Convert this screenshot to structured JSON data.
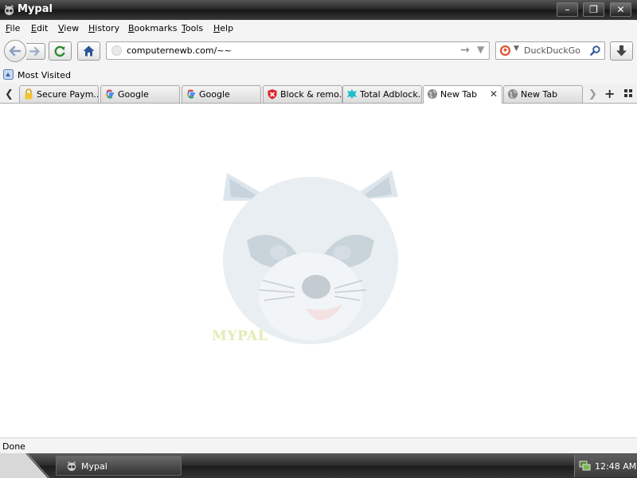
{
  "window": {
    "title": "Mypal",
    "minimize": "–",
    "maximize": "❐",
    "close": "✕"
  },
  "menu": [
    {
      "label": "File",
      "hotkey": "F",
      "rest": "ile"
    },
    {
      "label": "Edit",
      "hotkey": "E",
      "rest": "dit"
    },
    {
      "label": "View",
      "hotkey": "V",
      "rest": "iew"
    },
    {
      "label": "History",
      "hotkey": "H",
      "rest": "istory"
    },
    {
      "label": "Bookmarks",
      "hotkey": "B",
      "rest": "ookmarks"
    },
    {
      "label": "Tools",
      "hotkey": "T",
      "rest": "ools"
    },
    {
      "label": "Help",
      "hotkey": "H",
      "rest": "elp"
    }
  ],
  "navbar": {
    "url": "computernewb.com/~~",
    "search_placeholder": "DuckDuckGo",
    "search_engine_icon": "duckduckgo-icon"
  },
  "bookmarks": {
    "label": "Most Visited",
    "icon": "bookmarks-menu-icon"
  },
  "tabs": [
    {
      "label": "Secure Paym...",
      "icon": "lock-icon",
      "active": false
    },
    {
      "label": "Google",
      "icon": "google-icon",
      "active": false
    },
    {
      "label": "Google",
      "icon": "google-icon",
      "active": false
    },
    {
      "label": "Block & remo...",
      "icon": "shield-icon",
      "active": false
    },
    {
      "label": "Total Adblock...",
      "icon": "adblock-icon",
      "active": false
    },
    {
      "label": "New Tab",
      "icon": "globe-icon",
      "active": true
    },
    {
      "label": "New Tab",
      "icon": "globe-icon",
      "active": false
    }
  ],
  "content": {
    "watermark_text": "MYPAL",
    "mascot_icon": "raccoon-icon"
  },
  "status": {
    "text": "Done"
  },
  "taskbar": {
    "item_label": "Mypal",
    "clock": "12:48 AM"
  },
  "colors": {
    "titlebar": "#1c1c1c",
    "toolbar": "#f4f4f4",
    "active_tab": "#ffffff",
    "taskbar": "#2a2a2a"
  }
}
